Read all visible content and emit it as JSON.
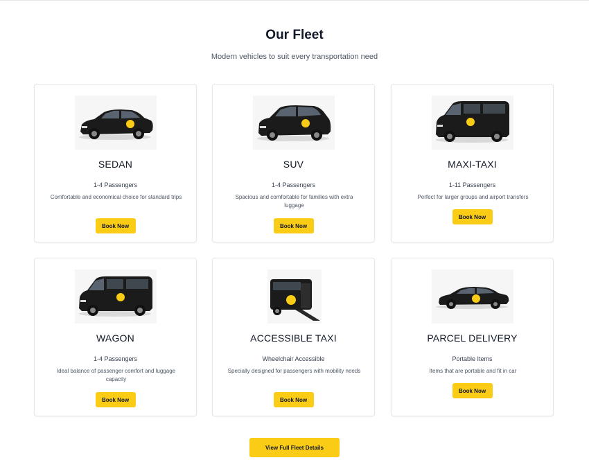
{
  "header": {
    "title": "Our Fleet",
    "subtitle": "Modern vehicles to suit every transportation need"
  },
  "fleet": [
    {
      "name": "SEDAN",
      "passengers": "1-4 Passengers",
      "description": "Comfortable and economical choice for standard trips",
      "button": "Book Now",
      "icon": "sedan-car-image"
    },
    {
      "name": "SUV",
      "passengers": "1-4 Passengers",
      "description": "Spacious and comfortable for families with extra luggage",
      "button": "Book Now",
      "icon": "suv-car-image"
    },
    {
      "name": "MAXI-TAXI",
      "passengers": "1-11 Passengers",
      "description": "Perfect for larger groups and airport transfers",
      "button": "Book Now",
      "icon": "van-image"
    },
    {
      "name": "WAGON",
      "passengers": "1-4 Passengers",
      "description": "Ideal balance of passenger comfort and luggage capacity",
      "button": "Book Now",
      "icon": "wagon-van-image"
    },
    {
      "name": "ACCESSIBLE TAXI",
      "passengers": "Wheelchair Accessible",
      "description": "Specially designed for passengers with mobility needs",
      "button": "Book Now",
      "icon": "accessible-van-image"
    },
    {
      "name": "PARCEL DELIVERY",
      "passengers": "Portable Items",
      "description": "Items that are portable and fit in car",
      "button": "Book Now",
      "icon": "parcel-car-image"
    }
  ],
  "footer": {
    "view_fleet_label": "View Full Fleet Details"
  },
  "colors": {
    "accent": "#facc15",
    "text": "#111827",
    "border": "#e5e7eb"
  }
}
